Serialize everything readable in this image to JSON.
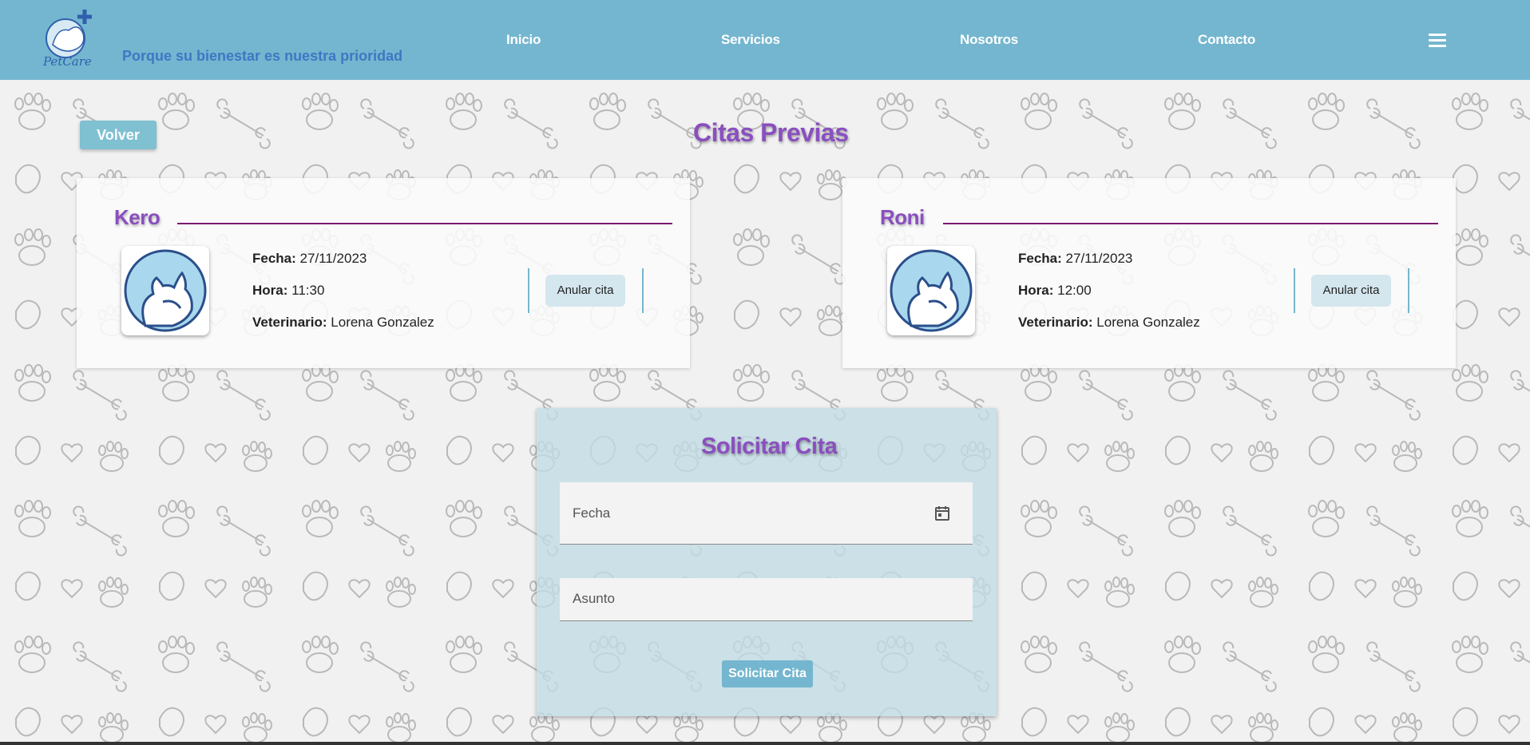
{
  "brand": {
    "name": "PetCare",
    "tagline": "Porque su bienestar es nuestra prioridad",
    "header_color": "#74b6cf"
  },
  "nav": {
    "inicio": "Inicio",
    "servicios": "Servicios",
    "nosotros": "Nosotros",
    "contacto": "Contacto",
    "menu_icon": "hamburger-menu-icon"
  },
  "back_button": "Volver",
  "previous_title": "Citas Previas",
  "appointments": [
    {
      "pet": "Kero",
      "fecha_label": "Fecha:",
      "fecha": "27/11/2023",
      "hora_label": "Hora:",
      "hora": "11:30",
      "vet_label": "Veterinario:",
      "vet": "Lorena Gonzalez",
      "cancel": "Anular cita"
    },
    {
      "pet": "Roni",
      "fecha_label": "Fecha:",
      "fecha": "27/11/2023",
      "hora_label": "Hora:",
      "hora": "12:00",
      "vet_label": "Veterinario:",
      "vet": "Lorena Gonzalez",
      "cancel": "Anular cita"
    }
  ],
  "request_form": {
    "title": "Solicitar Cita",
    "fecha_label": "Fecha",
    "asunto_label": "Asunto",
    "submit": "Solicitar Cita",
    "calendar_icon": "calendar-icon"
  },
  "colors": {
    "accent_purple": "#8a4fbf",
    "accent_blue": "#74b6cf",
    "rule": "#7a1a6e"
  }
}
